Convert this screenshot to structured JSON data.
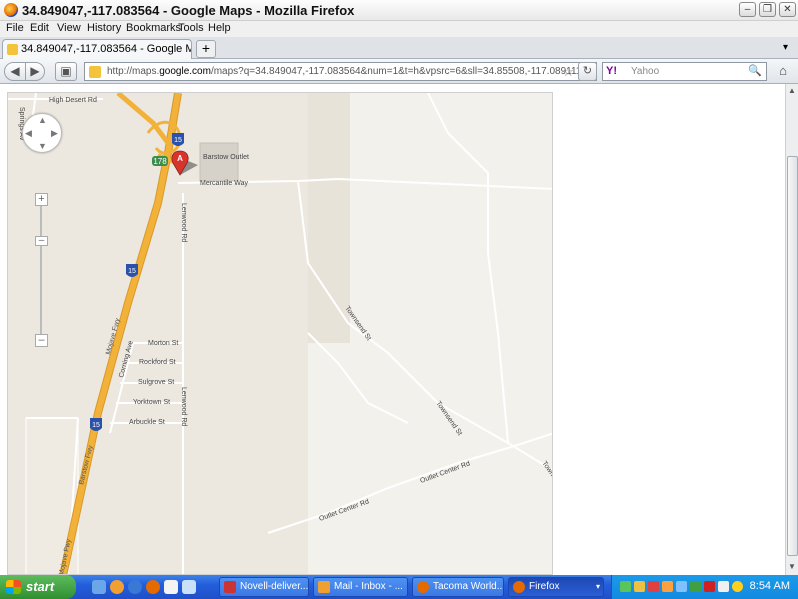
{
  "window": {
    "title": "34.849047,-117.083564 - Google Maps - Mozilla Firefox"
  },
  "menu": [
    "File",
    "Edit",
    "View",
    "History",
    "Bookmarks",
    "Tools",
    "Help"
  ],
  "tab": {
    "label": "34.849047,-117.083564 - Google Maps",
    "new_tab": "+"
  },
  "nav": {
    "url_prefix": "http://maps.",
    "url_domain": "google.com",
    "url_rest": "/maps?q=34.849047,-117.083564&num=1&t=h&vpsrc=6&sll=34.85508,-117.089111&sspn=",
    "search_placeholder": "Yahoo",
    "search_engine": "Y!"
  },
  "map": {
    "pin_label": "A",
    "streets": {
      "high_desert": "High Desert Rd",
      "springs": "Springs Av",
      "mercantile": "Mercantile Way",
      "lenwood_top": "Lenwood Rd",
      "lenwood_bottom": "Lenwood Rd",
      "morton": "Morton St",
      "rockford": "Rockford St",
      "sulgrove": "Sulgrove St",
      "yorktown": "Yorktown St",
      "arbuckle": "Arbuckle St",
      "corning": "Corning Ave",
      "mojave": "Mojave Fwy",
      "barstow_fwy": "Barstow Fwy",
      "mojave_bottom": "Mojave Fwy",
      "townsend_1": "Townsend St",
      "townsend_2": "Townsend St",
      "towne": "Towne",
      "outlet_1": "Outlet Center Rd",
      "outlet_2": "Outlet Center Rd",
      "outlet_place": "Barstow Outlet",
      "shield_178": "178",
      "shield_15_a": "15",
      "shield_15_b": "15",
      "shield_15_c": "15"
    }
  },
  "taskbar": {
    "start": "start",
    "tasks": [
      {
        "label": "Novell-deliver..."
      },
      {
        "label": "Mail - Inbox - ..."
      },
      {
        "label": "Tacoma World..."
      },
      {
        "label": "Firefox"
      }
    ],
    "clock": "8:54 AM"
  },
  "colors": {
    "freeway": "#f2b23a",
    "map_bg": "#ece8df",
    "pin": "#d9342c"
  }
}
